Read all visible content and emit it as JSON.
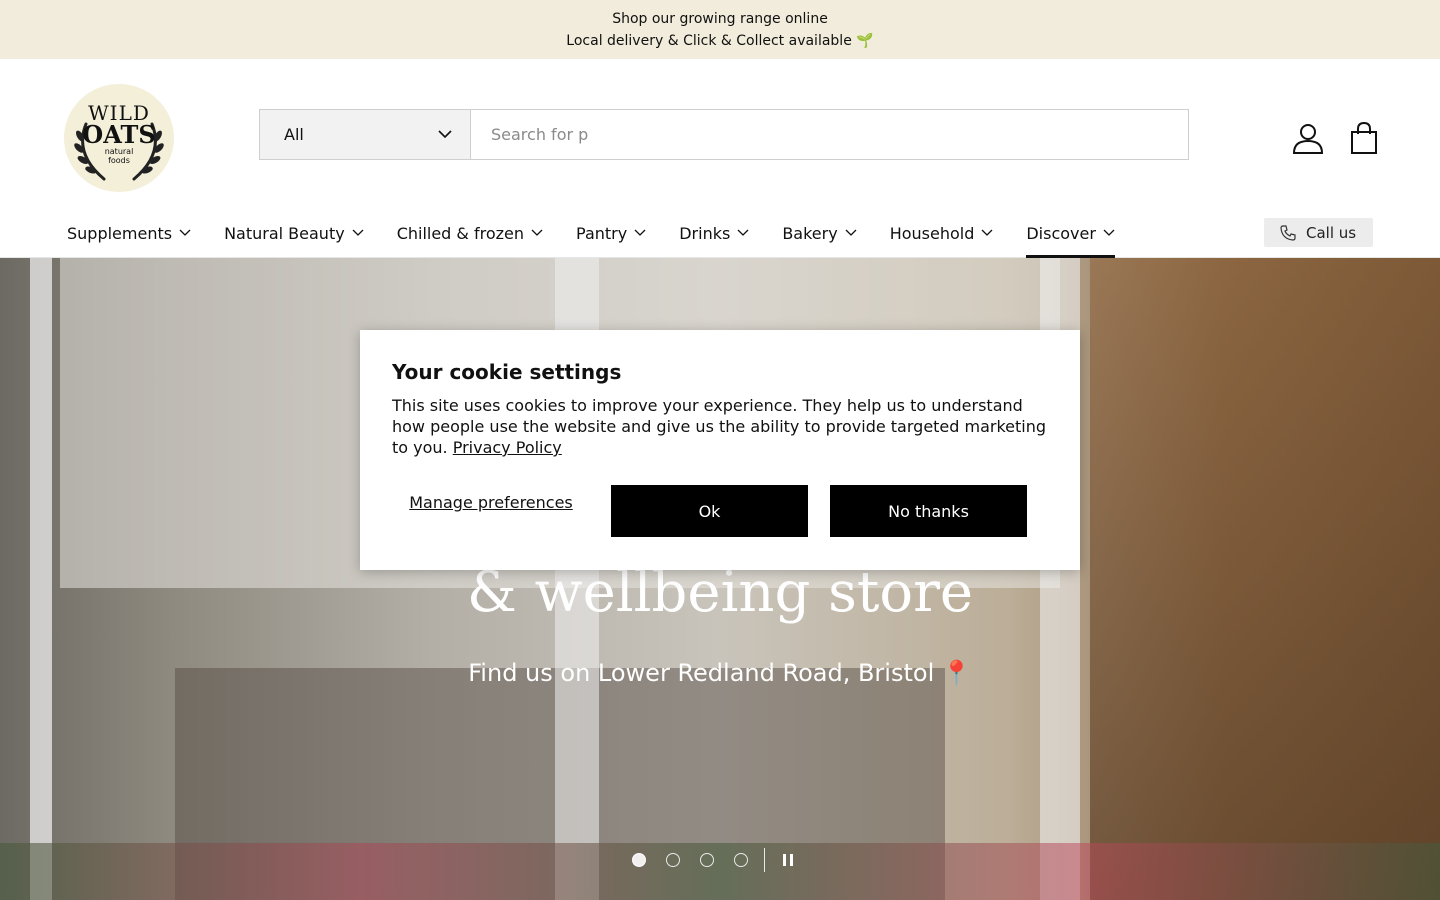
{
  "announcement": {
    "line1": "Shop our growing range online",
    "line2": "Local delivery & Click & Collect available 🌱"
  },
  "logo": {
    "line1": "WILD",
    "line2": "OATS",
    "line3": "natural",
    "line4": "foods"
  },
  "search": {
    "category": "All",
    "placeholder": "Search for p"
  },
  "nav": {
    "items": [
      {
        "label": "Supplements"
      },
      {
        "label": "Natural Beauty"
      },
      {
        "label": "Chilled & frozen"
      },
      {
        "label": "Pantry"
      },
      {
        "label": "Drinks"
      },
      {
        "label": "Bakery"
      },
      {
        "label": "Household"
      },
      {
        "label": "Discover"
      }
    ],
    "call_label": "Call us"
  },
  "hero": {
    "title": "& wellbeing store",
    "subtitle": "Find us on Lower Redland Road, Bristol 📍",
    "slides": 4,
    "active_slide": 1
  },
  "cookie": {
    "title": "Your cookie settings",
    "text": "This site uses cookies to improve your experience. They help us to understand how people use the website and give us the ability to provide targeted marketing to you. ",
    "privacy_link": "Privacy Policy",
    "manage_label": "Manage preferences",
    "ok_label": "Ok",
    "no_label": "No thanks"
  },
  "colors": {
    "announcement_bg": "#f1ecdb",
    "button_bg": "#000000",
    "call_bg": "#ececec"
  }
}
